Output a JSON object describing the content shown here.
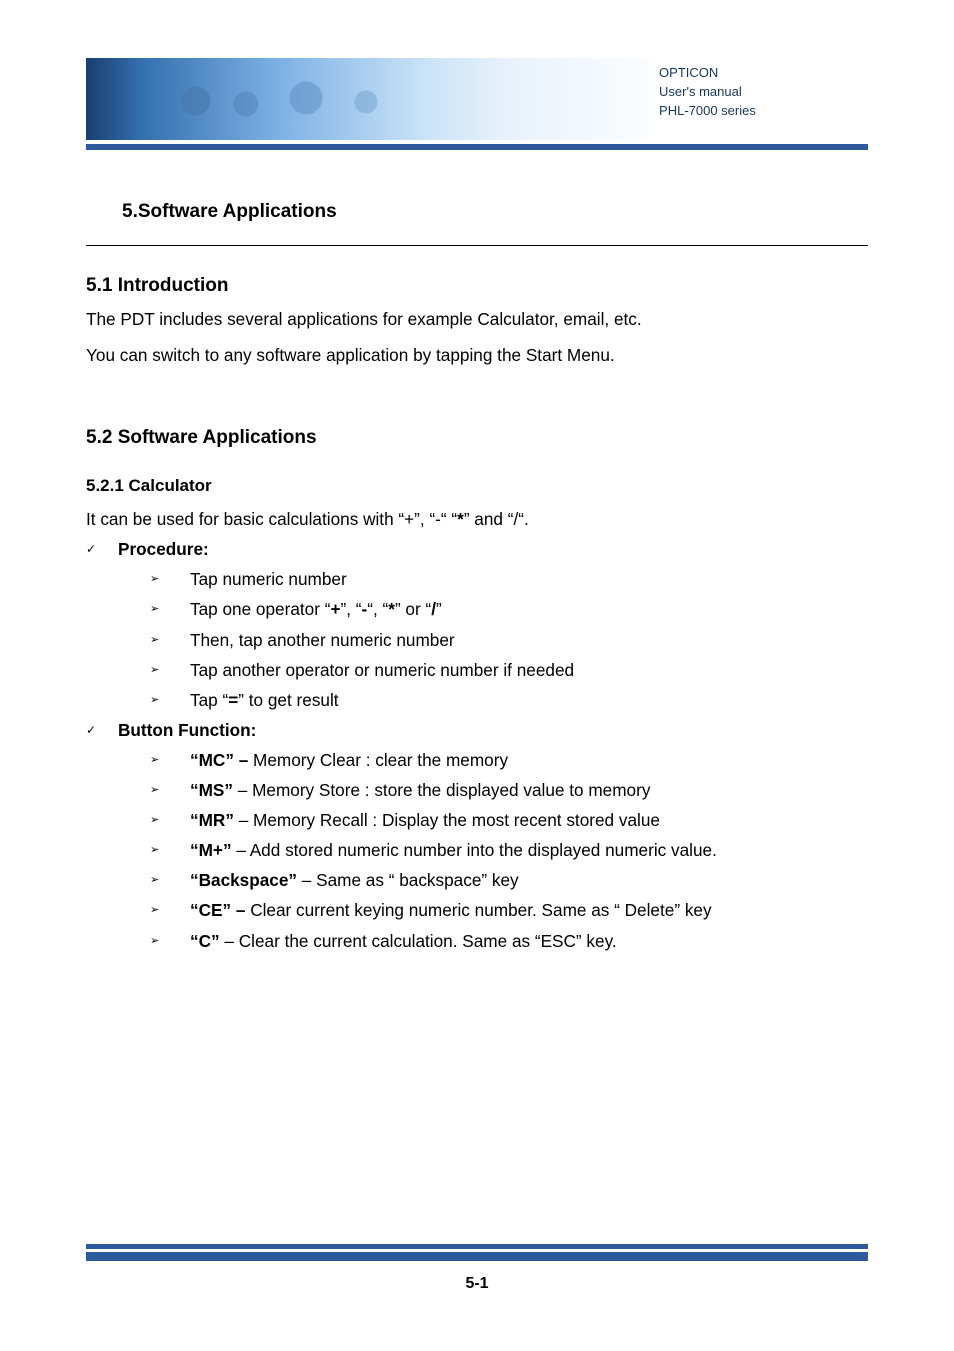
{
  "banner": {
    "line1": "OPTICON",
    "line2": "User's manual",
    "line3": "PHL-7000 series"
  },
  "section": {
    "title": "5.Software Applications"
  },
  "intro": {
    "heading": "5.1 Introduction",
    "p1": "The PDT includes several applications for example Calculator, email, etc.",
    "p2": "You can switch to any software application by tapping the Start Menu."
  },
  "apps": {
    "heading": "5.2 Software Applications",
    "calc": {
      "heading": "5.2.1 Calculator",
      "desc_a": "It can be used for basic calculations with “+”, “-“ “",
      "desc_star": "*",
      "desc_b": "” and “/“.",
      "procedure_label": "Procedure:",
      "steps": {
        "s1": "Tap numeric number",
        "s2_a": "Tap one operator “",
        "s2_op1": "+",
        "s2_b": "”, “",
        "s2_op2": "-",
        "s2_c": "“, “",
        "s2_op3": "*",
        "s2_d": "” or “",
        "s2_op4": "/",
        "s2_e": "”",
        "s3": "Then, tap another numeric number",
        "s4": "Tap another operator or numeric number if needed",
        "s5_a": "Tap “",
        "s5_eq": "=",
        "s5_b": "” to get result"
      },
      "buttonfn_label": "Button Function:",
      "buttons": {
        "mc": {
          "label": "“MC” – ",
          "rest": "Memory Clear : clear the memory"
        },
        "ms": {
          "label": "“MS”",
          "rest": " – Memory Store : store the displayed value to memory"
        },
        "mr": {
          "label": "“MR”",
          "rest": " – Memory Recall : Display the most recent stored value"
        },
        "mp": {
          "label": "“M+”",
          "rest": " – Add stored numeric number into the displayed numeric value."
        },
        "bs": {
          "label": "“Backspace”",
          "rest": " – Same as “ backspace” key"
        },
        "ce": {
          "label": "“CE”",
          "sep": " – ",
          "rest": "Clear current keying numeric number. Same as “ Delete” key"
        },
        "c": {
          "label": "“C”",
          "rest": " – Clear the current calculation. Same as “ESC” key."
        }
      }
    }
  },
  "page_number": "5-1"
}
